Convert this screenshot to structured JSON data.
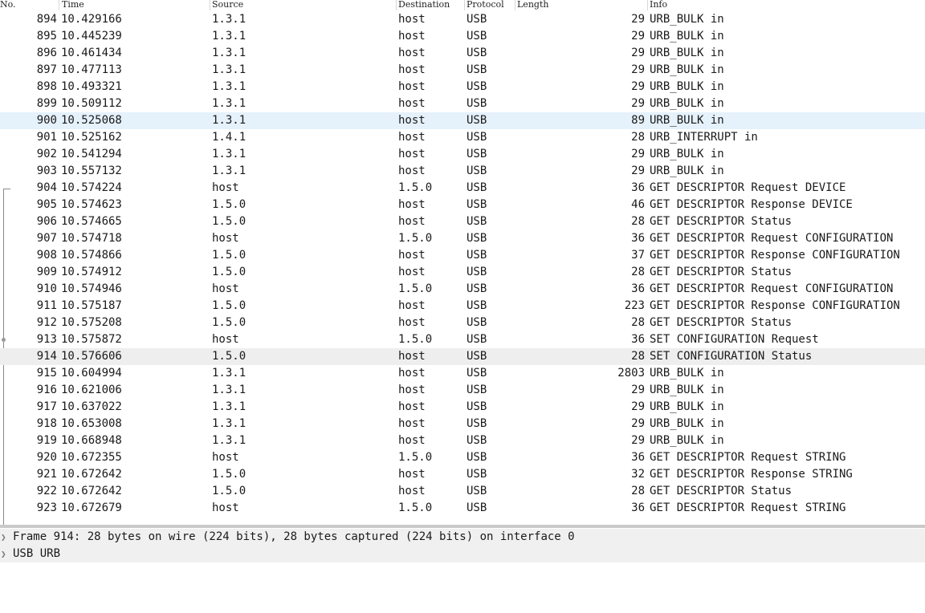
{
  "columns": {
    "no": "No.",
    "time": "Time",
    "source": "Source",
    "destination": "Destination",
    "protocol": "Protocol",
    "length": "Length",
    "info": "Info"
  },
  "packets": [
    {
      "no": "894",
      "time": "10.429166",
      "src": "1.3.1",
      "dst": "host",
      "proto": "USB",
      "len": "29",
      "info": "URB_BULK in"
    },
    {
      "no": "895",
      "time": "10.445239",
      "src": "1.3.1",
      "dst": "host",
      "proto": "USB",
      "len": "29",
      "info": "URB_BULK in"
    },
    {
      "no": "896",
      "time": "10.461434",
      "src": "1.3.1",
      "dst": "host",
      "proto": "USB",
      "len": "29",
      "info": "URB_BULK in"
    },
    {
      "no": "897",
      "time": "10.477113",
      "src": "1.3.1",
      "dst": "host",
      "proto": "USB",
      "len": "29",
      "info": "URB_BULK in"
    },
    {
      "no": "898",
      "time": "10.493321",
      "src": "1.3.1",
      "dst": "host",
      "proto": "USB",
      "len": "29",
      "info": "URB_BULK in"
    },
    {
      "no": "899",
      "time": "10.509112",
      "src": "1.3.1",
      "dst": "host",
      "proto": "USB",
      "len": "29",
      "info": "URB_BULK in"
    },
    {
      "no": "900",
      "time": "10.525068",
      "src": "1.3.1",
      "dst": "host",
      "proto": "USB",
      "len": "89",
      "info": "URB_BULK in"
    },
    {
      "no": "901",
      "time": "10.525162",
      "src": "1.4.1",
      "dst": "host",
      "proto": "USB",
      "len": "28",
      "info": "URB_INTERRUPT in"
    },
    {
      "no": "902",
      "time": "10.541294",
      "src": "1.3.1",
      "dst": "host",
      "proto": "USB",
      "len": "29",
      "info": "URB_BULK in"
    },
    {
      "no": "903",
      "time": "10.557132",
      "src": "1.3.1",
      "dst": "host",
      "proto": "USB",
      "len": "29",
      "info": "URB_BULK in"
    },
    {
      "no": "904",
      "time": "10.574224",
      "src": "host",
      "dst": "1.5.0",
      "proto": "USB",
      "len": "36",
      "info": "GET DESCRIPTOR Request DEVICE"
    },
    {
      "no": "905",
      "time": "10.574623",
      "src": "1.5.0",
      "dst": "host",
      "proto": "USB",
      "len": "46",
      "info": "GET DESCRIPTOR Response DEVICE"
    },
    {
      "no": "906",
      "time": "10.574665",
      "src": "1.5.0",
      "dst": "host",
      "proto": "USB",
      "len": "28",
      "info": "GET DESCRIPTOR Status"
    },
    {
      "no": "907",
      "time": "10.574718",
      "src": "host",
      "dst": "1.5.0",
      "proto": "USB",
      "len": "36",
      "info": "GET DESCRIPTOR Request CONFIGURATION"
    },
    {
      "no": "908",
      "time": "10.574866",
      "src": "1.5.0",
      "dst": "host",
      "proto": "USB",
      "len": "37",
      "info": "GET DESCRIPTOR Response CONFIGURATION"
    },
    {
      "no": "909",
      "time": "10.574912",
      "src": "1.5.0",
      "dst": "host",
      "proto": "USB",
      "len": "28",
      "info": "GET DESCRIPTOR Status"
    },
    {
      "no": "910",
      "time": "10.574946",
      "src": "host",
      "dst": "1.5.0",
      "proto": "USB",
      "len": "36",
      "info": "GET DESCRIPTOR Request CONFIGURATION"
    },
    {
      "no": "911",
      "time": "10.575187",
      "src": "1.5.0",
      "dst": "host",
      "proto": "USB",
      "len": "223",
      "info": "GET DESCRIPTOR Response CONFIGURATION"
    },
    {
      "no": "912",
      "time": "10.575208",
      "src": "1.5.0",
      "dst": "host",
      "proto": "USB",
      "len": "28",
      "info": "GET DESCRIPTOR Status"
    },
    {
      "no": "913",
      "time": "10.575872",
      "src": "host",
      "dst": "1.5.0",
      "proto": "USB",
      "len": "36",
      "info": "SET CONFIGURATION Request"
    },
    {
      "no": "914",
      "time": "10.576606",
      "src": "1.5.0",
      "dst": "host",
      "proto": "USB",
      "len": "28",
      "info": "SET CONFIGURATION Status"
    },
    {
      "no": "915",
      "time": "10.604994",
      "src": "1.3.1",
      "dst": "host",
      "proto": "USB",
      "len": "2803",
      "info": "URB_BULK in"
    },
    {
      "no": "916",
      "time": "10.621006",
      "src": "1.3.1",
      "dst": "host",
      "proto": "USB",
      "len": "29",
      "info": "URB_BULK in"
    },
    {
      "no": "917",
      "time": "10.637022",
      "src": "1.3.1",
      "dst": "host",
      "proto": "USB",
      "len": "29",
      "info": "URB_BULK in"
    },
    {
      "no": "918",
      "time": "10.653008",
      "src": "1.3.1",
      "dst": "host",
      "proto": "USB",
      "len": "29",
      "info": "URB_BULK in"
    },
    {
      "no": "919",
      "time": "10.668948",
      "src": "1.3.1",
      "dst": "host",
      "proto": "USB",
      "len": "29",
      "info": "URB_BULK in"
    },
    {
      "no": "920",
      "time": "10.672355",
      "src": "host",
      "dst": "1.5.0",
      "proto": "USB",
      "len": "36",
      "info": "GET DESCRIPTOR Request STRING"
    },
    {
      "no": "921",
      "time": "10.672642",
      "src": "1.5.0",
      "dst": "host",
      "proto": "USB",
      "len": "32",
      "info": "GET DESCRIPTOR Response STRING"
    },
    {
      "no": "922",
      "time": "10.672642",
      "src": "1.5.0",
      "dst": "host",
      "proto": "USB",
      "len": "28",
      "info": "GET DESCRIPTOR Status"
    },
    {
      "no": "923",
      "time": "10.672679",
      "src": "host",
      "dst": "1.5.0",
      "proto": "USB",
      "len": "36",
      "info": "GET DESCRIPTOR Request STRING"
    }
  ],
  "selection": {
    "hovered_no": "900",
    "selected_no": "914"
  },
  "details": [
    {
      "icon": "chevron-right-icon",
      "text": "Frame 914: 28 bytes on wire (224 bits), 28 bytes captured (224 bits) on interface 0"
    },
    {
      "icon": "chevron-right-icon",
      "text": "USB URB"
    }
  ],
  "colors": {
    "hover_row": "#e5f1fb",
    "selected_row": "#eeeeee",
    "pane_divider": "#c9c9c9"
  }
}
